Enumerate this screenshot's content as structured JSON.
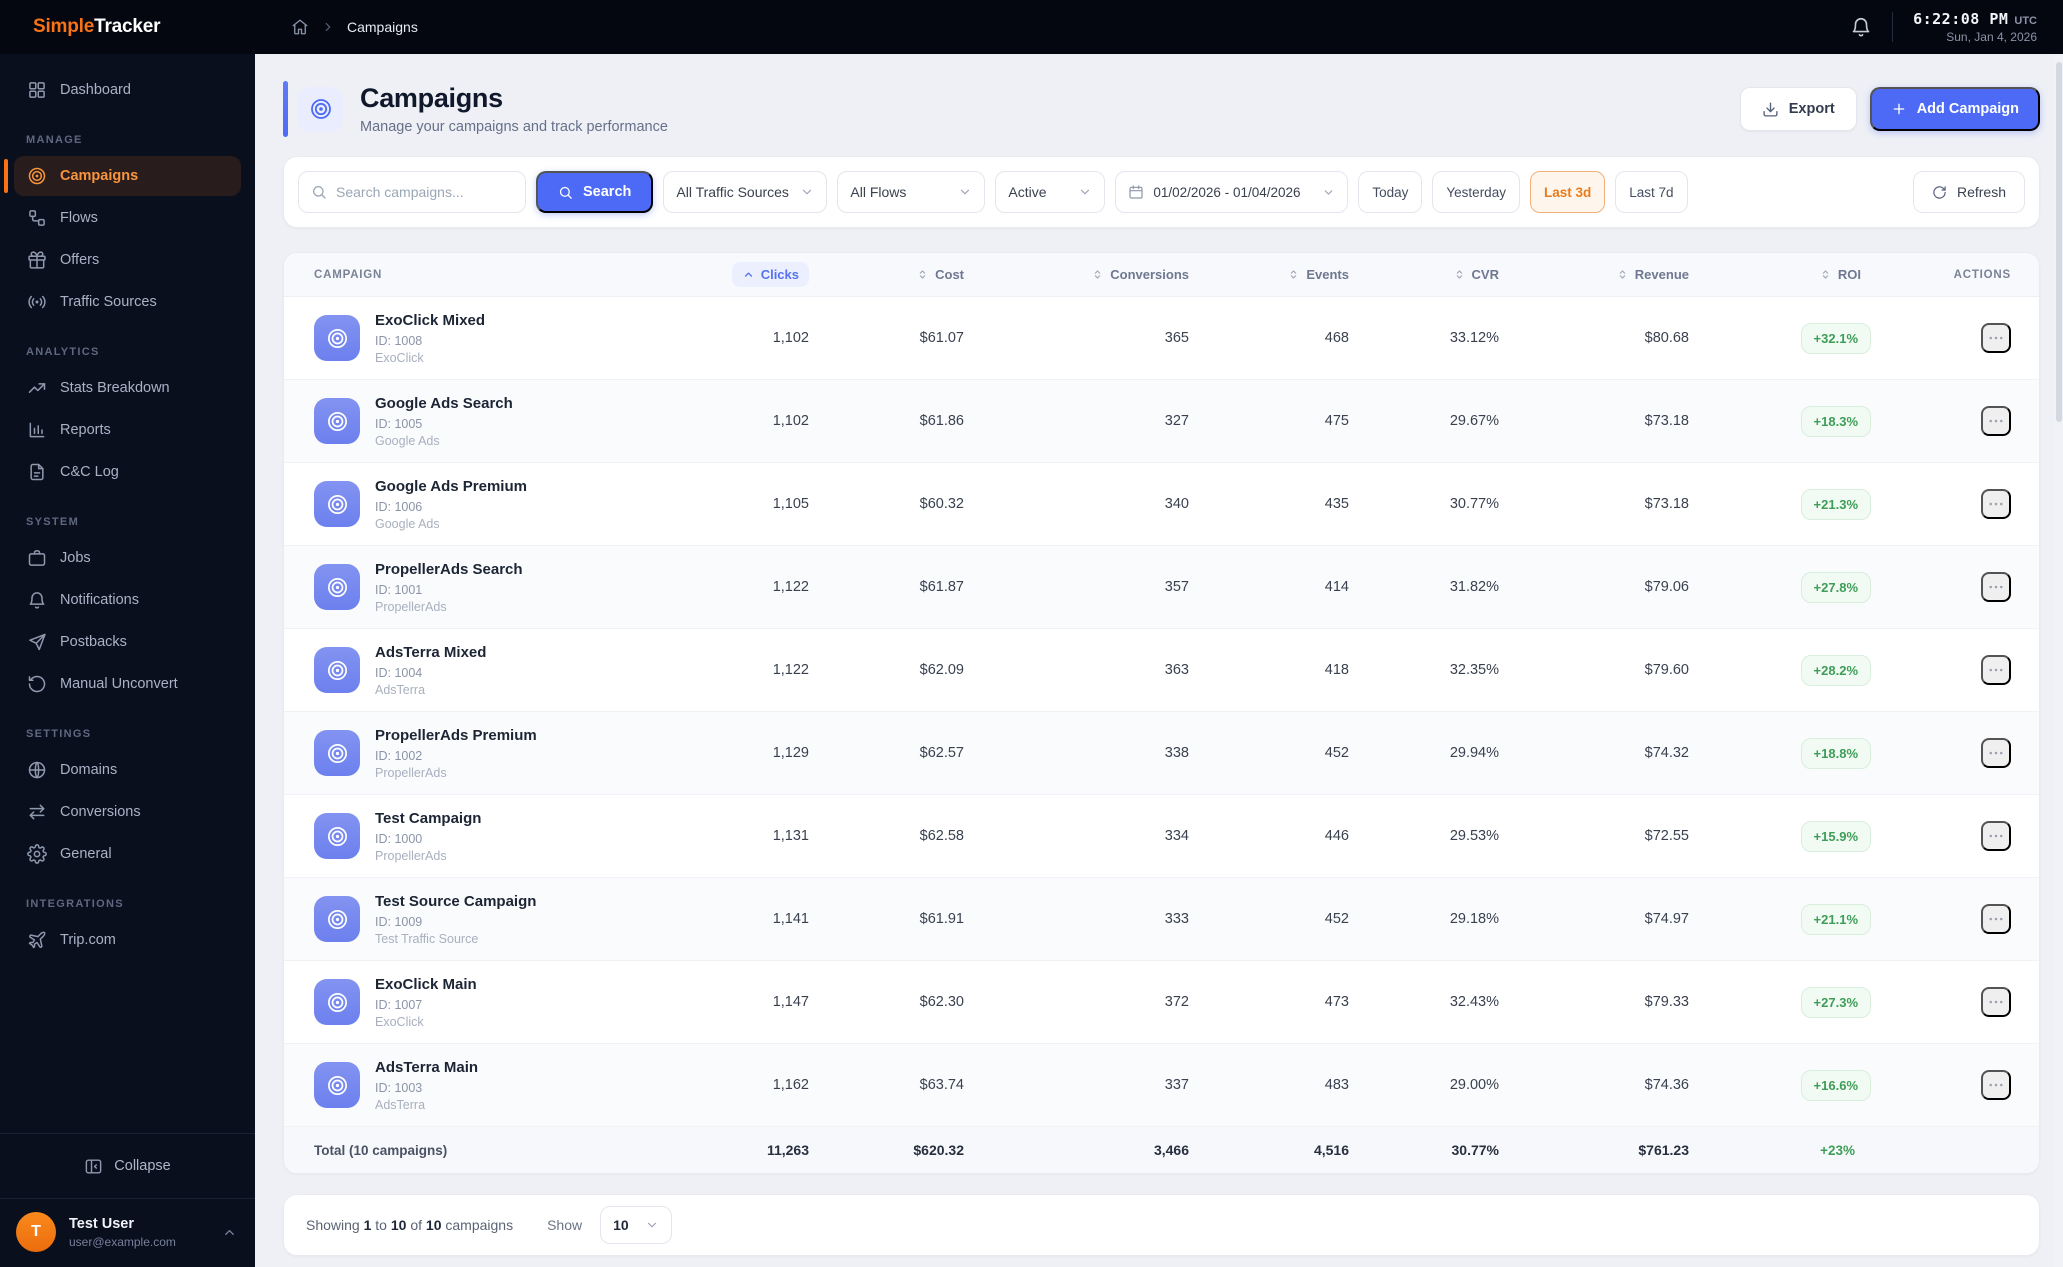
{
  "colors": {
    "accent_blue": "#4c6af5",
    "accent_orange": "#f97316",
    "positive_green": "#3e9e58",
    "row_icon_indigo": "#7688ef"
  },
  "topbar": {
    "logo_part1": "Simple",
    "logo_part2": "Tracker",
    "breadcrumb_current": "Campaigns",
    "clock_time": "6:22:08 PM",
    "clock_tz": "UTC",
    "clock_date": "Sun, Jan 4, 2026"
  },
  "sidebar": {
    "sections": [
      {
        "title": "",
        "items": [
          {
            "id": "dashboard",
            "label": "Dashboard",
            "icon": "dashboard",
            "active": false
          }
        ]
      },
      {
        "title": "MANAGE",
        "items": [
          {
            "id": "campaigns",
            "label": "Campaigns",
            "icon": "target",
            "active": true
          },
          {
            "id": "flows",
            "label": "Flows",
            "icon": "flow",
            "active": false
          },
          {
            "id": "offers",
            "label": "Offers",
            "icon": "gift",
            "active": false
          },
          {
            "id": "traffic-sources",
            "label": "Traffic Sources",
            "icon": "broadcast",
            "active": false
          }
        ]
      },
      {
        "title": "ANALYTICS",
        "items": [
          {
            "id": "stats-breakdown",
            "label": "Stats Breakdown",
            "icon": "trend",
            "active": false
          },
          {
            "id": "reports",
            "label": "Reports",
            "icon": "barchart",
            "active": false
          },
          {
            "id": "cc-log",
            "label": "C&C Log",
            "icon": "document",
            "active": false
          }
        ]
      },
      {
        "title": "SYSTEM",
        "items": [
          {
            "id": "jobs",
            "label": "Jobs",
            "icon": "briefcase",
            "active": false
          },
          {
            "id": "notifications",
            "label": "Notifications",
            "icon": "bell",
            "active": false
          },
          {
            "id": "postbacks",
            "label": "Postbacks",
            "icon": "send",
            "active": false
          },
          {
            "id": "manual-unconvert",
            "label": "Manual Unconvert",
            "icon": "rotate",
            "active": false
          }
        ]
      },
      {
        "title": "SETTINGS",
        "items": [
          {
            "id": "domains",
            "label": "Domains",
            "icon": "globe",
            "active": false
          },
          {
            "id": "conversions",
            "label": "Conversions",
            "icon": "swap",
            "active": false
          },
          {
            "id": "general",
            "label": "General",
            "icon": "gear",
            "active": false
          }
        ]
      },
      {
        "title": "INTEGRATIONS",
        "items": [
          {
            "id": "trip-com",
            "label": "Trip.com",
            "icon": "plane",
            "active": false
          }
        ]
      }
    ],
    "collapse_label": "Collapse",
    "user": {
      "initial": "T",
      "name": "Test User",
      "email": "user@example.com"
    }
  },
  "page": {
    "title": "Campaigns",
    "subtitle": "Manage your campaigns and track performance",
    "export_label": "Export",
    "add_campaign_label": "Add Campaign"
  },
  "filters": {
    "search_placeholder": "Search campaigns...",
    "search_button": "Search",
    "traffic_sources_value": "All Traffic Sources",
    "flows_value": "All Flows",
    "status_value": "Active",
    "date_range": "01/02/2026 - 01/04/2026",
    "quick_ranges": [
      {
        "label": "Today",
        "active": false
      },
      {
        "label": "Yesterday",
        "active": false
      },
      {
        "label": "Last 3d",
        "active": true
      },
      {
        "label": "Last 7d",
        "active": false
      }
    ],
    "refresh_label": "Refresh"
  },
  "table": {
    "columns": [
      {
        "key": "campaign",
        "label": "CAMPAIGN",
        "kind": "static",
        "align": "left"
      },
      {
        "key": "clicks",
        "label": "Clicks",
        "kind": "sortable",
        "align": "right",
        "sorted": "asc"
      },
      {
        "key": "cost",
        "label": "Cost",
        "kind": "sortable",
        "align": "right"
      },
      {
        "key": "conversions",
        "label": "Conversions",
        "kind": "sortable",
        "align": "right"
      },
      {
        "key": "events",
        "label": "Events",
        "kind": "sortable",
        "align": "right"
      },
      {
        "key": "cvr",
        "label": "CVR",
        "kind": "sortable",
        "align": "right"
      },
      {
        "key": "revenue",
        "label": "Revenue",
        "kind": "sortable",
        "align": "right"
      },
      {
        "key": "roi",
        "label": "ROI",
        "kind": "sortable",
        "align": "roi"
      },
      {
        "key": "actions",
        "label": "ACTIONS",
        "kind": "static",
        "align": "right"
      }
    ],
    "rows": [
      {
        "name": "ExoClick Mixed",
        "id": "ID: 1008",
        "source": "ExoClick",
        "clicks": "1,102",
        "cost": "$61.07",
        "conversions": "365",
        "events": "468",
        "cvr": "33.12%",
        "revenue": "$80.68",
        "roi": "+32.1%"
      },
      {
        "name": "Google Ads Search",
        "id": "ID: 1005",
        "source": "Google Ads",
        "clicks": "1,102",
        "cost": "$61.86",
        "conversions": "327",
        "events": "475",
        "cvr": "29.67%",
        "revenue": "$73.18",
        "roi": "+18.3%"
      },
      {
        "name": "Google Ads Premium",
        "id": "ID: 1006",
        "source": "Google Ads",
        "clicks": "1,105",
        "cost": "$60.32",
        "conversions": "340",
        "events": "435",
        "cvr": "30.77%",
        "revenue": "$73.18",
        "roi": "+21.3%"
      },
      {
        "name": "PropellerAds Search",
        "id": "ID: 1001",
        "source": "PropellerAds",
        "clicks": "1,122",
        "cost": "$61.87",
        "conversions": "357",
        "events": "414",
        "cvr": "31.82%",
        "revenue": "$79.06",
        "roi": "+27.8%"
      },
      {
        "name": "AdsTerra Mixed",
        "id": "ID: 1004",
        "source": "AdsTerra",
        "clicks": "1,122",
        "cost": "$62.09",
        "conversions": "363",
        "events": "418",
        "cvr": "32.35%",
        "revenue": "$79.60",
        "roi": "+28.2%"
      },
      {
        "name": "PropellerAds Premium",
        "id": "ID: 1002",
        "source": "PropellerAds",
        "clicks": "1,129",
        "cost": "$62.57",
        "conversions": "338",
        "events": "452",
        "cvr": "29.94%",
        "revenue": "$74.32",
        "roi": "+18.8%"
      },
      {
        "name": "Test Campaign",
        "id": "ID: 1000",
        "source": "PropellerAds",
        "clicks": "1,131",
        "cost": "$62.58",
        "conversions": "334",
        "events": "446",
        "cvr": "29.53%",
        "revenue": "$72.55",
        "roi": "+15.9%"
      },
      {
        "name": "Test Source Campaign",
        "id": "ID: 1009",
        "source": "Test Traffic Source",
        "clicks": "1,141",
        "cost": "$61.91",
        "conversions": "333",
        "events": "452",
        "cvr": "29.18%",
        "revenue": "$74.97",
        "roi": "+21.1%"
      },
      {
        "name": "ExoClick Main",
        "id": "ID: 1007",
        "source": "ExoClick",
        "clicks": "1,147",
        "cost": "$62.30",
        "conversions": "372",
        "events": "473",
        "cvr": "32.43%",
        "revenue": "$79.33",
        "roi": "+27.3%"
      },
      {
        "name": "AdsTerra Main",
        "id": "ID: 1003",
        "source": "AdsTerra",
        "clicks": "1,162",
        "cost": "$63.74",
        "conversions": "337",
        "events": "483",
        "cvr": "29.00%",
        "revenue": "$74.36",
        "roi": "+16.6%"
      }
    ],
    "total": {
      "label": "Total (10 campaigns)",
      "clicks": "11,263",
      "cost": "$620.32",
      "conversions": "3,466",
      "events": "4,516",
      "cvr": "30.77%",
      "revenue": "$761.23",
      "roi": "+23%"
    }
  },
  "pagination": {
    "prefix": "Showing",
    "from": "1",
    "to_word": "to",
    "to": "10",
    "of_word": "of",
    "total": "10",
    "suffix": "campaigns",
    "show_label": "Show",
    "page_size": "10"
  }
}
